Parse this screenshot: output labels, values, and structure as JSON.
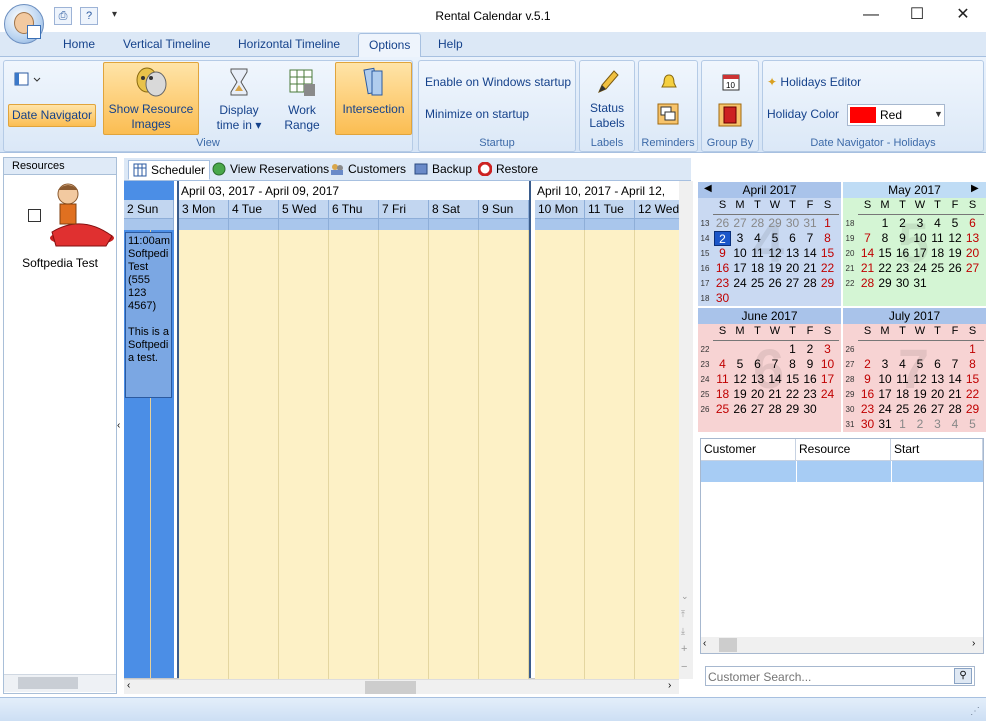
{
  "window": {
    "title": "Rental Calendar v.5.1",
    "minimize": "—",
    "maximize": "☐",
    "close": "✕"
  },
  "quick_access": {
    "print": "⎙",
    "help": "?",
    "customize": "▾"
  },
  "ribbon_tabs": [
    "Home",
    "Vertical Timeline",
    "Horizontal Timeline",
    "Options",
    "Help"
  ],
  "ribbon": {
    "view": {
      "label": "View",
      "date_navigator": "Date Navigator",
      "show_resource_images_1": "Show Resource",
      "show_resource_images_2": "Images",
      "display_time_1": "Display",
      "display_time_2": "time in ▾",
      "work_range_1": "Work",
      "work_range_2": "Range",
      "intersection": "Intersection"
    },
    "startup": {
      "label": "Startup",
      "enable": "Enable on Windows startup",
      "minimize": "Minimize on startup"
    },
    "labels": {
      "label": "Labels",
      "status_1": "Status",
      "status_2": "Labels"
    },
    "reminders": {
      "label": "Reminders"
    },
    "group_by": {
      "label": "Group By"
    },
    "holidays": {
      "label": "Date Navigator - Holidays",
      "editor": "Holidays Editor",
      "color_label": "Holiday Color",
      "color_value": "Red",
      "color_hex": "#ff0000"
    }
  },
  "resources": {
    "header": "Resources",
    "items": [
      {
        "name": "Softpedia Test"
      }
    ]
  },
  "subtabs": [
    "Scheduler",
    "View Reservations",
    "Customers",
    "Backup",
    "Restore"
  ],
  "scheduler": {
    "week1": "April 03, 2017 - April 09, 2017",
    "week2": "April 10, 2017 - April 12, 2017",
    "day0": "2 Sun",
    "week1_days": [
      "3 Mon",
      "4 Tue",
      "5 Wed",
      "6 Thu",
      "7 Fri",
      "8 Sat",
      "9 Sun"
    ],
    "week2_days": [
      "10 Mon",
      "11 Tue",
      "12 Wed"
    ],
    "appointment": {
      "time": "11:00am",
      "lines": [
        "Softpedi",
        "Test",
        "(555",
        "123",
        "4567)"
      ],
      "note_lines": [
        "This is a",
        "Softpedi",
        "a test."
      ]
    }
  },
  "calendars": [
    {
      "name": "April 2017",
      "big": "4",
      "bg": "#c9d9f2",
      "weeks": [
        "13",
        "14",
        "15",
        "16",
        "17",
        "18"
      ],
      "rows": [
        [
          "26",
          "27",
          "28",
          "29",
          "30",
          "31",
          "1"
        ],
        [
          "2",
          "3",
          "4",
          "5",
          "6",
          "7",
          "8"
        ],
        [
          "9",
          "10",
          "11",
          "12",
          "13",
          "14",
          "15"
        ],
        [
          "16",
          "17",
          "18",
          "19",
          "20",
          "21",
          "22"
        ],
        [
          "23",
          "24",
          "25",
          "26",
          "27",
          "28",
          "29"
        ],
        [
          "30",
          "",
          "",
          "",
          "",
          "",
          ""
        ]
      ]
    },
    {
      "name": "May 2017",
      "big": "5",
      "bg": "#d4f5d4",
      "weeks": [
        "18",
        "19",
        "20",
        "21",
        "22"
      ],
      "rows": [
        [
          "",
          "1",
          "2",
          "3",
          "4",
          "5",
          "6"
        ],
        [
          "7",
          "8",
          "9",
          "10",
          "11",
          "12",
          "13"
        ],
        [
          "14",
          "15",
          "16",
          "17",
          "18",
          "19",
          "20"
        ],
        [
          "21",
          "22",
          "23",
          "24",
          "25",
          "26",
          "27"
        ],
        [
          "28",
          "29",
          "30",
          "31",
          "",
          "",
          ""
        ]
      ]
    },
    {
      "name": "June 2017",
      "big": "6",
      "bg": "#f7d3d3",
      "weeks": [
        "22",
        "23",
        "24",
        "25",
        "26"
      ],
      "rows": [
        [
          "",
          "",
          "",
          "",
          "1",
          "2",
          "3"
        ],
        [
          "4",
          "5",
          "6",
          "7",
          "8",
          "9",
          "10"
        ],
        [
          "11",
          "12",
          "13",
          "14",
          "15",
          "16",
          "17"
        ],
        [
          "18",
          "19",
          "20",
          "21",
          "22",
          "23",
          "24"
        ],
        [
          "25",
          "26",
          "27",
          "28",
          "29",
          "30",
          ""
        ]
      ]
    },
    {
      "name": "July 2017",
      "big": "7",
      "bg": "#f7d3d3",
      "weeks": [
        "26",
        "27",
        "28",
        "29",
        "30",
        "31"
      ],
      "rows": [
        [
          "",
          "",
          "",
          "",
          "",
          "",
          "1"
        ],
        [
          "2",
          "3",
          "4",
          "5",
          "6",
          "7",
          "8"
        ],
        [
          "9",
          "10",
          "11",
          "12",
          "13",
          "14",
          "15"
        ],
        [
          "16",
          "17",
          "18",
          "19",
          "20",
          "21",
          "22"
        ],
        [
          "23",
          "24",
          "25",
          "26",
          "27",
          "28",
          "29"
        ],
        [
          "30",
          "31",
          "1",
          "2",
          "3",
          "4",
          "5"
        ]
      ]
    }
  ],
  "day_names": [
    "S",
    "M",
    "T",
    "W",
    "T",
    "F",
    "S"
  ],
  "grid": {
    "columns": [
      "Customer",
      "Resource",
      "Start"
    ]
  },
  "search": {
    "placeholder": "Customer Search..."
  }
}
